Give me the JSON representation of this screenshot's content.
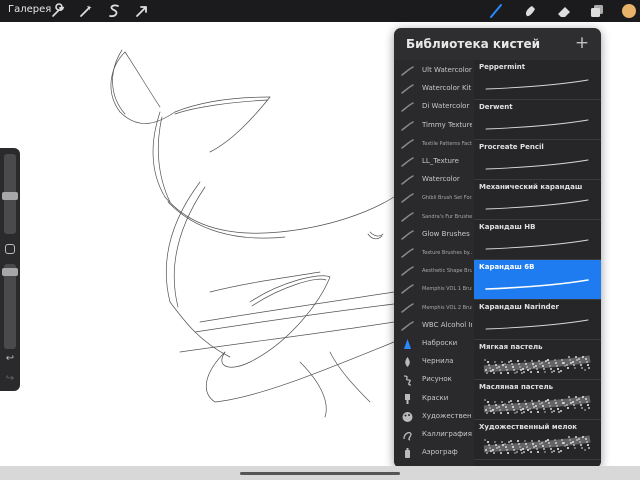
{
  "topbar": {
    "gallery_label": "Галерея",
    "left_tools": [
      "wrench-icon",
      "magic-wand-icon",
      "selection-s-icon",
      "arrow-cursor-icon"
    ],
    "right_tools": [
      "brush-icon",
      "smudge-icon",
      "eraser-icon",
      "layers-icon"
    ],
    "accent": "#2a88ff",
    "color_swatch": "#e8b26a"
  },
  "panel": {
    "title": "Библиотека кистей",
    "add_label": "+",
    "categories": [
      {
        "label": "Ult Watercolor",
        "icon": "brush-stroke-icon",
        "tiny": false
      },
      {
        "label": "Watercolor Kit",
        "icon": "brush-stroke-icon",
        "tiny": false
      },
      {
        "label": "Di Watercolor",
        "icon": "brush-stroke-icon",
        "tiny": false
      },
      {
        "label": "Timmy Textures",
        "icon": "brush-stroke-icon",
        "tiny": false
      },
      {
        "label": "Textile Patterns Fact...",
        "icon": "brush-stroke-icon",
        "tiny": true
      },
      {
        "label": "LL_Texture",
        "icon": "brush-stroke-icon",
        "tiny": false
      },
      {
        "label": "Watercolor",
        "icon": "brush-stroke-icon",
        "tiny": false
      },
      {
        "label": "Ghibli Brush Set For...",
        "icon": "brush-stroke-icon",
        "tiny": true
      },
      {
        "label": "Sandra's Fur Brushes",
        "icon": "brush-stroke-icon",
        "tiny": true
      },
      {
        "label": "Glow Brushes",
        "icon": "brush-stroke-icon",
        "tiny": false
      },
      {
        "label": "Texture Brushes by...",
        "icon": "brush-stroke-icon",
        "tiny": true
      },
      {
        "label": "Aesthetic Shape Brus...",
        "icon": "brush-stroke-icon",
        "tiny": true
      },
      {
        "label": "Memphis VOL 1 Brus...",
        "icon": "brush-stroke-icon",
        "tiny": true
      },
      {
        "label": "Memphis VOL 2 Brus...",
        "icon": "brush-stroke-icon",
        "tiny": true
      },
      {
        "label": "WBC Alcohol Inks",
        "icon": "brush-stroke-icon",
        "tiny": false
      },
      {
        "label": "Наброски",
        "icon": "pencil-tip-icon",
        "tiny": false
      },
      {
        "label": "Чернила",
        "icon": "ink-drop-icon",
        "tiny": false
      },
      {
        "label": "Рисунок",
        "icon": "squiggle-icon",
        "tiny": false
      },
      {
        "label": "Краски",
        "icon": "paint-brush-icon",
        "tiny": false
      },
      {
        "label": "Художественные",
        "icon": "palette-icon",
        "tiny": false
      },
      {
        "label": "Каллиграфия",
        "icon": "calligraphy-icon",
        "tiny": false
      },
      {
        "label": "Аэрограф",
        "icon": "airbrush-icon",
        "tiny": false
      }
    ],
    "brushes": [
      {
        "name": "Peppermint",
        "style": "thin",
        "selected": false
      },
      {
        "name": "Derwent",
        "style": "thin",
        "selected": false
      },
      {
        "name": "Procreate Pencil",
        "style": "thin",
        "selected": false
      },
      {
        "name": "Механический карандаш",
        "style": "thin",
        "selected": false
      },
      {
        "name": "Карандаш HB",
        "style": "thin",
        "selected": false
      },
      {
        "name": "Карандаш 6B",
        "style": "medium",
        "selected": true
      },
      {
        "name": "Карандаш Narinder",
        "style": "thin",
        "selected": false
      },
      {
        "name": "Мягкая пастель",
        "style": "texture",
        "selected": false
      },
      {
        "name": "Масляная пастель",
        "style": "texture",
        "selected": false
      },
      {
        "name": "Художественный мелок",
        "style": "texture",
        "selected": false
      }
    ]
  }
}
